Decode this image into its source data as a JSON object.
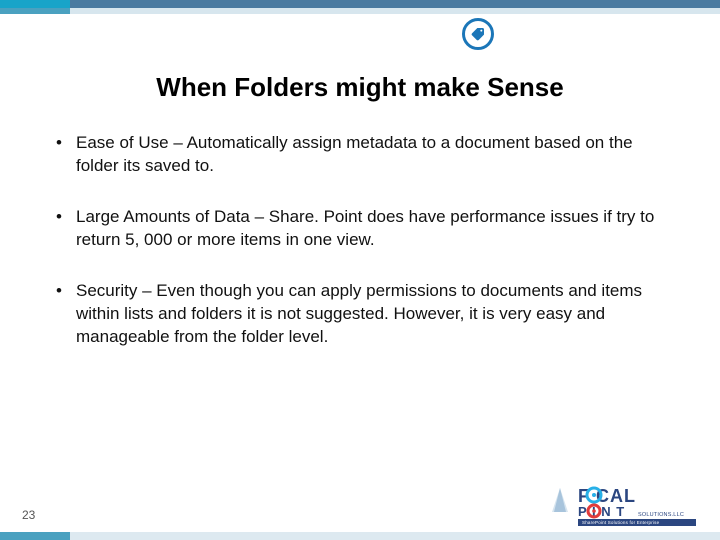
{
  "title": "When Folders might make Sense",
  "bullets": [
    "Ease of Use – Automatically assign metadata to a document based on the folder its saved to.",
    "Large Amounts of Data – Share. Point does have performance issues if try to return 5, 000 or more items in one view.",
    "Security – Even though you can apply permissions to documents and items within lists and folders it is not suggested.  However, it is very easy and manageable from the folder level."
  ],
  "page_number": "23",
  "logo": {
    "line1": "F   CAL",
    "line2": "P   I N T",
    "line3": "SOLUTIONS.LLC",
    "tagline": "SharePoint Solutions for Enterprise"
  }
}
